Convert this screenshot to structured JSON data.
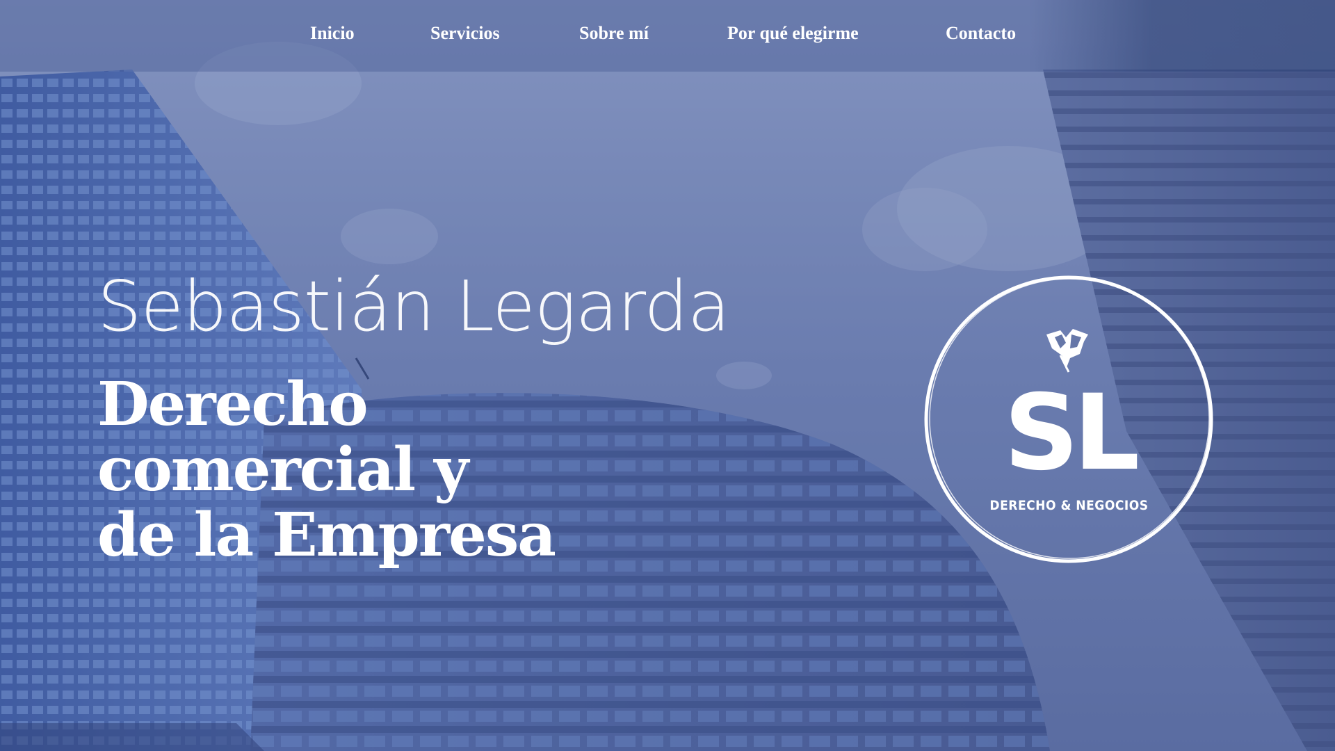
{
  "nav": {
    "items": [
      {
        "label": "Inicio"
      },
      {
        "label": "Servicios"
      },
      {
        "label": "Sobre mí"
      },
      {
        "label": "Por qué elegirme"
      },
      {
        "label": "Contacto"
      }
    ]
  },
  "hero": {
    "name": "Sebastián Legarda",
    "subtitle_lines": [
      "Derecho",
      "comercial y",
      "de la Empresa"
    ]
  },
  "logo": {
    "initials": "SL",
    "tagline": "DERECHO & NEGOCIOS",
    "icon": "graduation-scroll-icon"
  },
  "colors": {
    "overlay": "#5a6a9c",
    "text": "#ffffff"
  }
}
